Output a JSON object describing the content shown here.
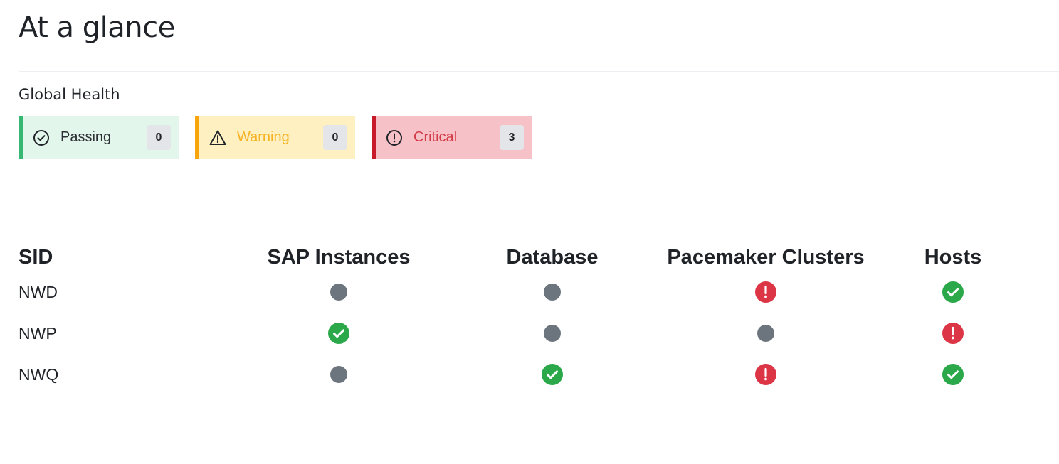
{
  "page": {
    "title": "At a glance"
  },
  "global_health": {
    "title": "Global Health",
    "cards": [
      {
        "key": "passing",
        "label": "Passing",
        "count": "0",
        "icon": "check-circle-icon"
      },
      {
        "key": "warning",
        "label": "Warning",
        "count": "0",
        "icon": "warning-triangle-icon"
      },
      {
        "key": "critical",
        "label": "Critical",
        "count": "3",
        "icon": "exclamation-circle-icon"
      }
    ]
  },
  "colors": {
    "passing": "#2ba84a",
    "critical": "#dc3545",
    "unknown": "#6c757d"
  },
  "table": {
    "headers": [
      "SID",
      "SAP Instances",
      "Database",
      "Pacemaker Clusters",
      "Hosts"
    ],
    "rows": [
      {
        "sid": "NWD",
        "statuses": [
          "unknown",
          "unknown",
          "critical",
          "passing"
        ]
      },
      {
        "sid": "NWP",
        "statuses": [
          "passing",
          "unknown",
          "unknown",
          "critical"
        ]
      },
      {
        "sid": "NWQ",
        "statuses": [
          "unknown",
          "passing",
          "critical",
          "passing"
        ]
      }
    ]
  }
}
